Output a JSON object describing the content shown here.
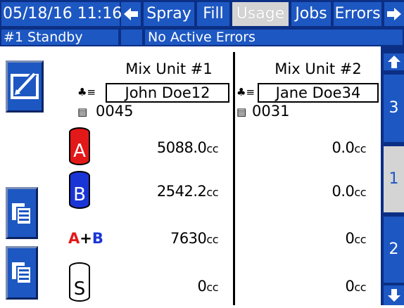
{
  "header": {
    "datetime": "05/18/16 11:16",
    "nav_left": "←",
    "nav_right": "➡",
    "tabs": [
      "Spray",
      "Fill",
      "Usage",
      "Jobs",
      "Errors"
    ],
    "active_tab": "Usage"
  },
  "status": {
    "mode": "#1 Standby",
    "errors": "No Active Errors"
  },
  "units": [
    {
      "title": "Mix Unit #1",
      "user": "John Doe12",
      "job": "0045",
      "a": "5088.0",
      "b": "2542.2",
      "ab": "7630",
      "s": "0"
    },
    {
      "title": "Mix Unit #2",
      "user": "Jane Doe34",
      "job": "0031",
      "a": "0.0",
      "b": "0.0",
      "ab": "0",
      "s": "0"
    }
  ],
  "unit_suffix": "cc",
  "icons": {
    "a_label": "A",
    "b_label": "B",
    "ab_a": "A",
    "ab_plus": "+",
    "ab_b": "B",
    "s_label": "S",
    "user_icon": "♣≡",
    "job_icon": "▤"
  },
  "scroll": {
    "up": "▲",
    "down": "▼",
    "pages": [
      "3",
      "1",
      "2"
    ],
    "selected": "1"
  },
  "colors": {
    "accent_dark": "#0b2f84",
    "accent": "#1d57c2",
    "a_red": "#e31818",
    "b_blue": "#1a35d6"
  }
}
